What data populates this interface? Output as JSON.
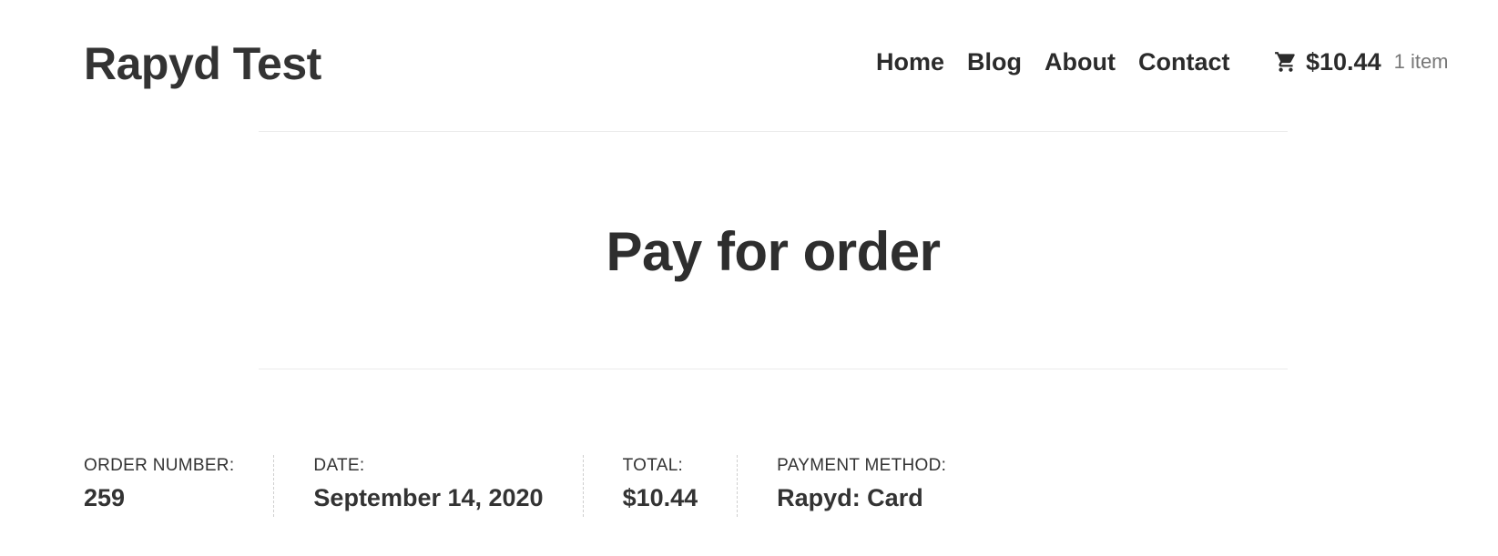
{
  "header": {
    "site_title": "Rapyd Test",
    "nav": [
      "Home",
      "Blog",
      "About",
      "Contact"
    ],
    "cart": {
      "icon": "shopping-cart-icon",
      "amount": "$10.44",
      "count": "1 item"
    }
  },
  "page": {
    "title": "Pay for order"
  },
  "order_overview": {
    "order_number_label": "ORDER NUMBER:",
    "order_number": "259",
    "date_label": "DATE:",
    "date": "September 14, 2020",
    "total_label": "TOTAL:",
    "total": "$10.44",
    "payment_method_label": "PAYMENT METHOD:",
    "payment_method": "Rapyd: Card"
  }
}
